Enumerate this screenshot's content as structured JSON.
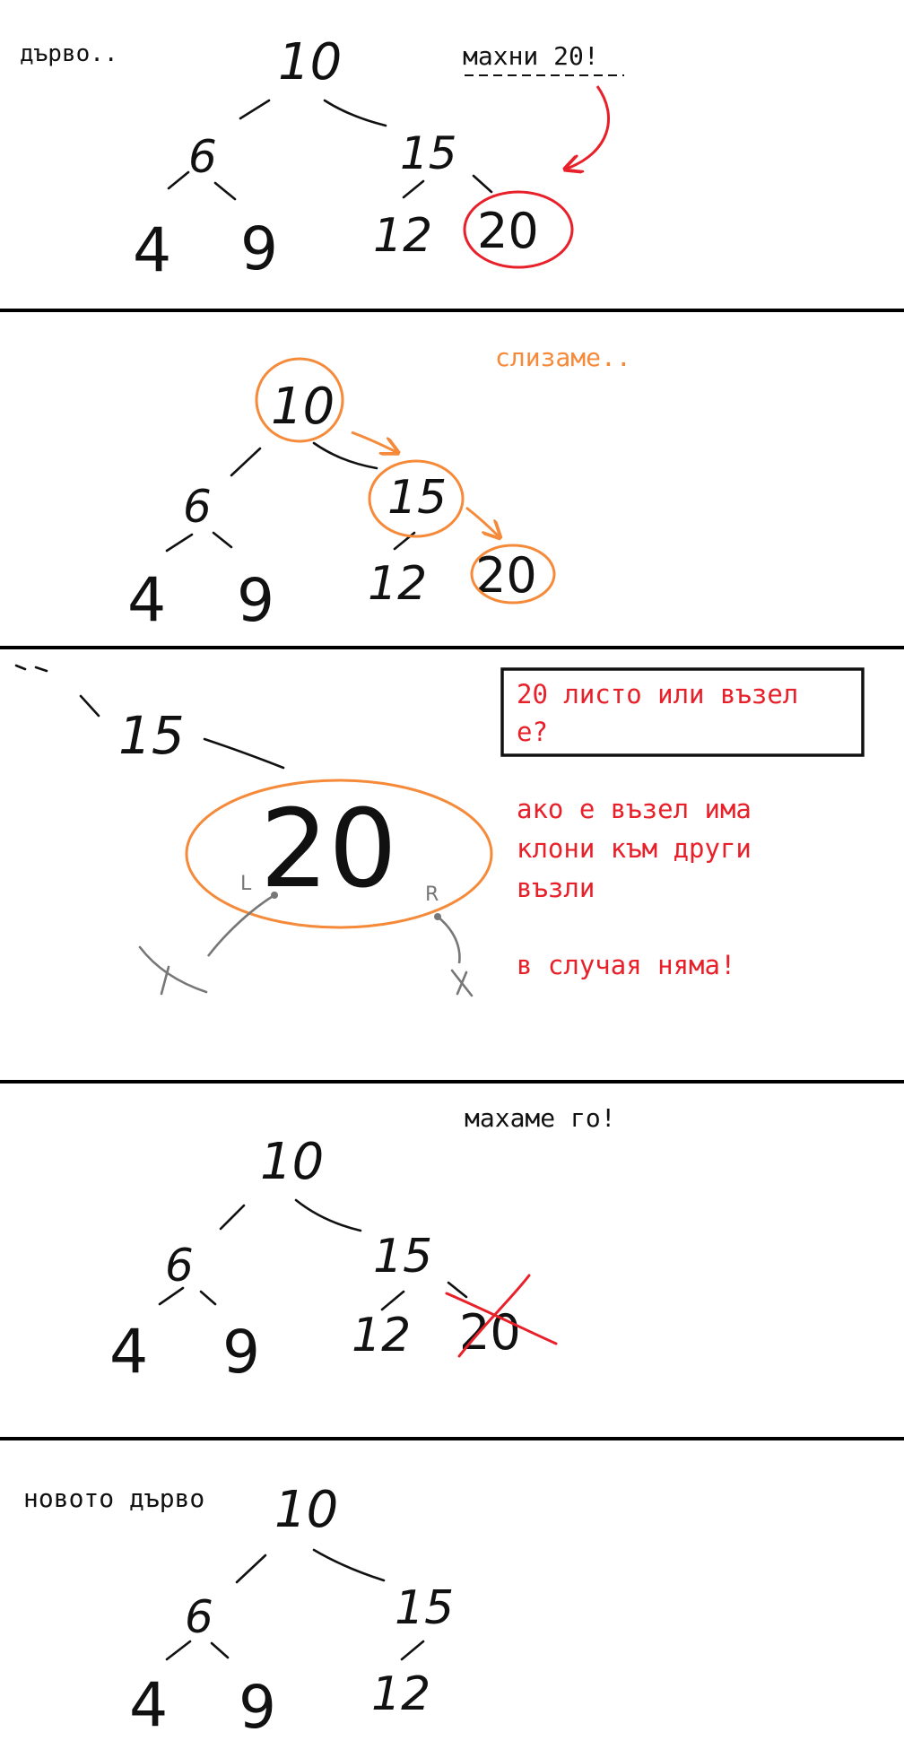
{
  "colors": {
    "ink": "#111111",
    "red": "#e8202a",
    "orange": "#f58a3a",
    "gray": "#777777",
    "divider": "#000000"
  },
  "panels": [
    {
      "caption": "дърво..",
      "note": "махни 20!"
    },
    {
      "note": "слизаме.."
    },
    {
      "question": [
        "20 листо или възел",
        "е?"
      ],
      "explanation": [
        "ако е възел има",
        "клони към други",
        "възли"
      ],
      "conclusion": "в случая няма!",
      "parent_value": "15",
      "node_value": "20",
      "left_mark": "L",
      "right_mark": "R"
    },
    {
      "note": "махаме го!"
    },
    {
      "caption": "новото дърво"
    }
  ],
  "trees": {
    "full": [
      "10",
      "6",
      "15",
      "4",
      "9",
      "12",
      "20"
    ],
    "result": [
      "10",
      "6",
      "15",
      "4",
      "9",
      "12"
    ]
  }
}
